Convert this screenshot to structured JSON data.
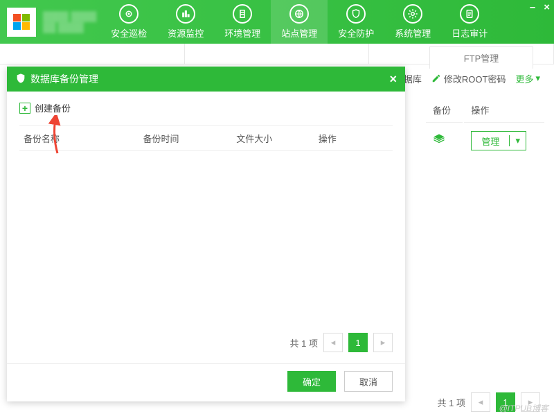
{
  "header": {
    "nav": [
      {
        "label": "安全巡检",
        "icon": "scan"
      },
      {
        "label": "资源监控",
        "icon": "monitor"
      },
      {
        "label": "环境管理",
        "icon": "env"
      },
      {
        "label": "站点管理",
        "icon": "site"
      },
      {
        "label": "安全防护",
        "icon": "shield"
      },
      {
        "label": "系统管理",
        "icon": "system"
      },
      {
        "label": "日志审计",
        "icon": "log"
      }
    ],
    "active_index": 3
  },
  "ftp_tab": "FTP管理",
  "side_actions": {
    "db_label": "库据库",
    "root_label": "修改ROOT密码",
    "more_label": "更多"
  },
  "manage_table": {
    "cols": [
      "备份",
      "操作"
    ],
    "row": {
      "manage_btn": "管理"
    }
  },
  "main_pagination": {
    "total_text": "共 1 项",
    "current": "1"
  },
  "dialog": {
    "title": "数据库备份管理",
    "create_label": "创建备份",
    "columns": [
      "备份名称",
      "备份时间",
      "文件大小",
      "操作"
    ],
    "pagination": {
      "total_text": "共 1 项",
      "current": "1"
    },
    "ok": "确定",
    "cancel": "取消"
  },
  "watermark": "@ITPUB博客"
}
